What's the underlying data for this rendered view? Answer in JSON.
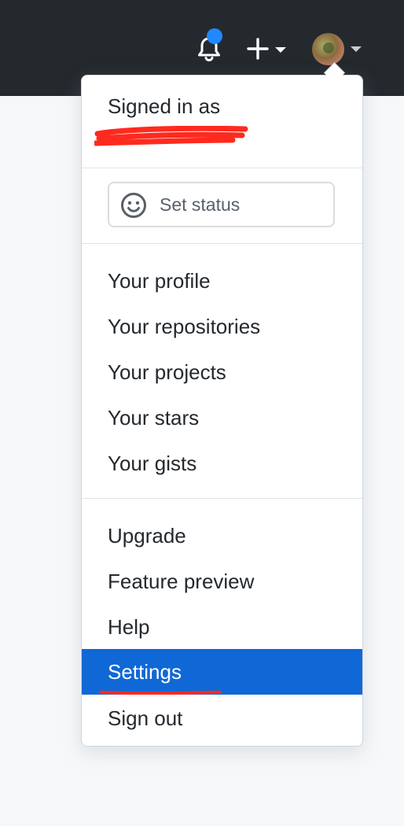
{
  "header": {
    "notifications_icon": "bell-icon",
    "notification_indicator_color": "#2188ff",
    "create_icon": "plus-icon",
    "avatar_icon": "avatar"
  },
  "menu": {
    "signed_in_label": "Signed in as",
    "set_status": {
      "icon": "smiley-icon",
      "label": "Set status"
    },
    "group1": [
      "Your profile",
      "Your repositories",
      "Your projects",
      "Your stars",
      "Your gists"
    ],
    "group2": [
      "Upgrade",
      "Feature preview",
      "Help",
      "Settings",
      "Sign out"
    ],
    "selected_item": "Settings",
    "selected_color": "#1068d6",
    "annotation_color": "#ff2a1f"
  }
}
